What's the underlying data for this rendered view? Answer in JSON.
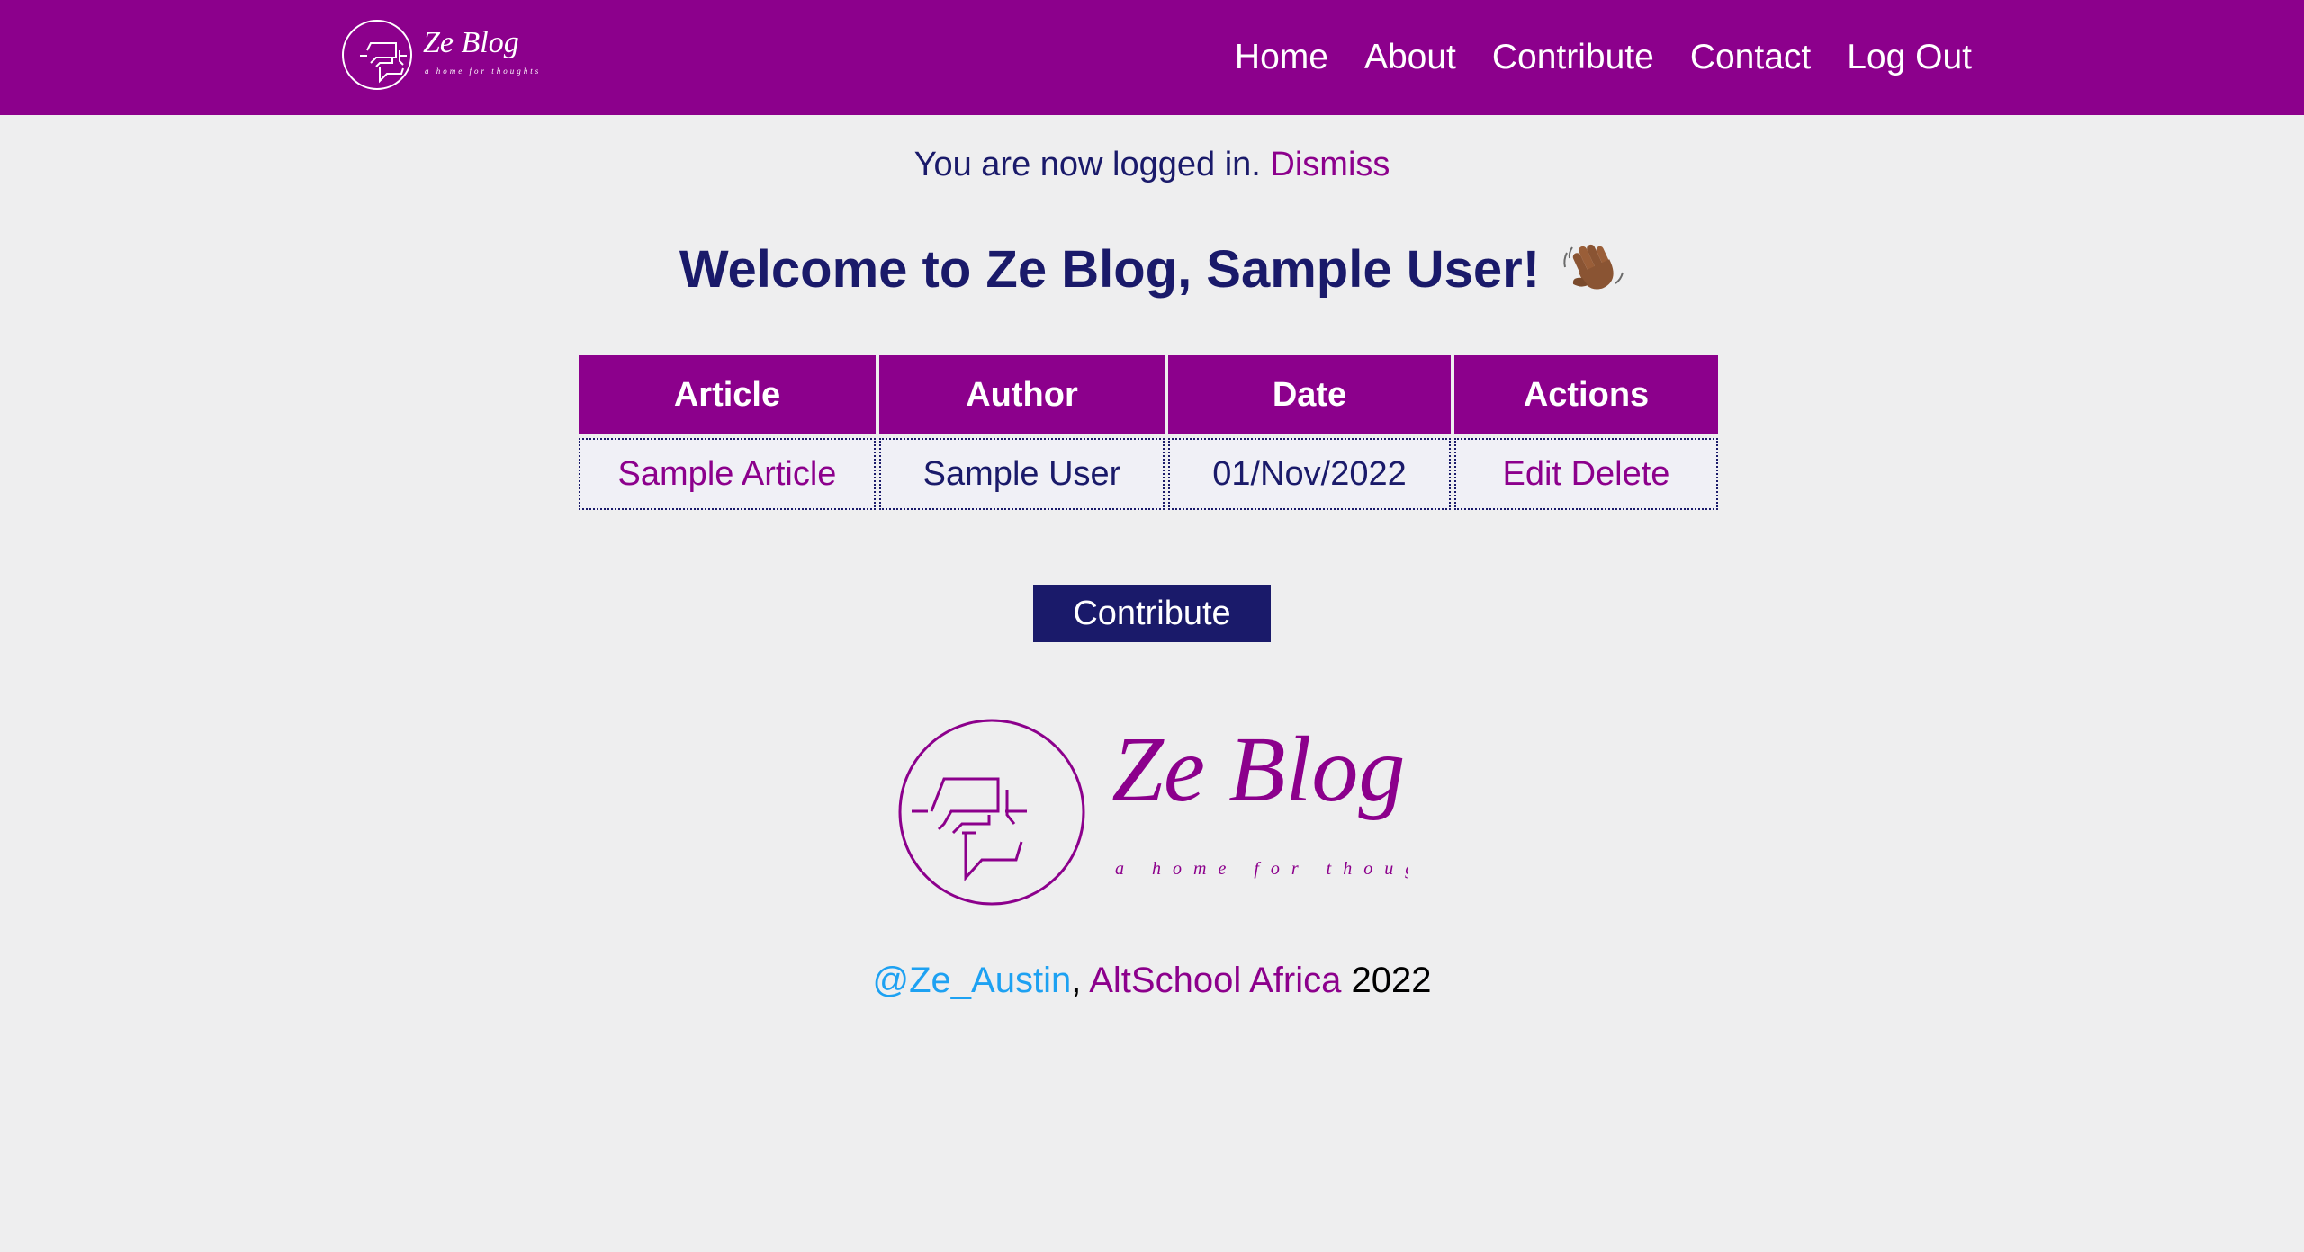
{
  "brand": {
    "name": "Ze Blog",
    "tagline": "a home for thoughts",
    "primary_color": "#8c008c",
    "secondary_color": "#1a1a6a"
  },
  "nav": {
    "items": [
      {
        "label": "Home"
      },
      {
        "label": "About"
      },
      {
        "label": "Contribute"
      },
      {
        "label": "Contact"
      },
      {
        "label": "Log Out"
      }
    ]
  },
  "flash": {
    "message": "You are now logged in.",
    "dismiss_label": "Dismiss"
  },
  "welcome": {
    "title": "Welcome to Ze Blog, Sample User!",
    "emoji_icon": "waving-hand-icon"
  },
  "articles_table": {
    "headers": [
      "Article",
      "Author",
      "Date",
      "Actions"
    ],
    "rows": [
      {
        "article": "Sample Article",
        "author": "Sample User",
        "date": "01/Nov/2022",
        "edit_label": "Edit",
        "delete_label": "Delete"
      }
    ]
  },
  "contribute_button": {
    "label": "Contribute"
  },
  "footer": {
    "twitter_handle": "@Ze_Austin",
    "separator": ",",
    "school": "AltSchool Africa",
    "year": "2022"
  }
}
